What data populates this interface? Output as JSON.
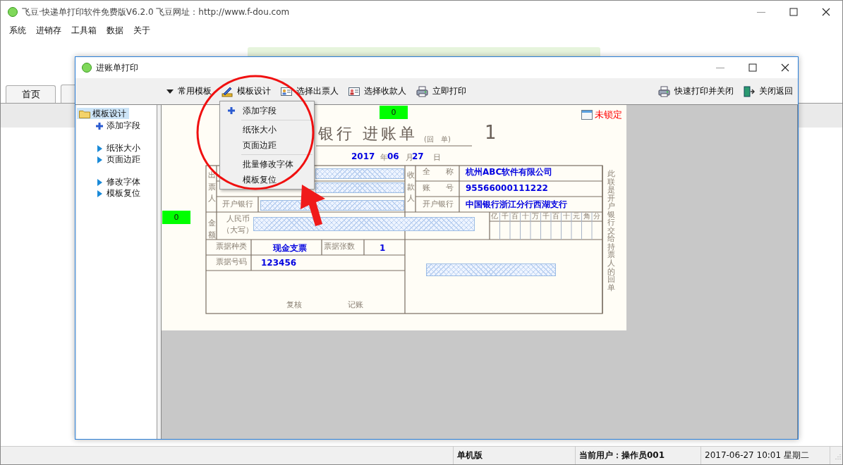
{
  "window": {
    "title": "飞豆·快递单打印软件免费版V6.2.0  飞豆网址：http://www.f-dou.com"
  },
  "menu": [
    "系统",
    "进销存",
    "工具箱",
    "数据",
    "关于"
  ],
  "tabs": [
    "首页"
  ],
  "status_bar": [
    {
      "text": "单机版",
      "kind": "label"
    },
    {
      "text": "当前用户：操作员001",
      "kind": "label"
    },
    {
      "text": "2017-06-27 10:01 星期二",
      "kind": "clock"
    }
  ],
  "dialog": {
    "title": "进账单打印",
    "toolbar_left": [
      "常用模板",
      "模板设计",
      "选择出票人",
      "选择收款人",
      "立即打印"
    ],
    "toolbar_right": [
      "快速打印并关闭",
      "关闭返回"
    ],
    "tree": {
      "label": "模板设计",
      "selected": true,
      "sections": [
        {
          "children": [
            {
              "label": "添加字段",
              "kind": "add"
            }
          ]
        },
        {
          "children": [
            {
              "label": "纸张大小",
              "kind": "action"
            },
            {
              "label": "页面边距",
              "kind": "action"
            }
          ]
        },
        {
          "children": [
            {
              "label": "修改字体",
              "kind": "action"
            },
            {
              "label": "模板复位",
              "kind": "action"
            }
          ]
        }
      ]
    },
    "dropdown_menu": [
      {
        "items": [
          {
            "label": "添加字段",
            "kind": "add"
          }
        ]
      },
      {
        "items": [
          {
            "label": "纸张大小",
            "kind": "plain"
          },
          {
            "label": "页面边距",
            "kind": "plain"
          }
        ]
      },
      {
        "items": [
          {
            "label": "批量修改字体",
            "kind": "plain"
          },
          {
            "label": "模板复位",
            "kind": "plain"
          }
        ]
      }
    ],
    "canvas": {
      "counters": [
        "0",
        "0"
      ],
      "lock_status": "未锁定",
      "form": [
        {
          "text": "银行  进账单",
          "kind": "title"
        },
        {
          "text": "(回　单)",
          "kind": "small"
        },
        {
          "text": "1",
          "kind": "number"
        },
        {
          "text": "2017",
          "kind": "value"
        },
        {
          "text": "年",
          "kind": "printed"
        },
        {
          "text": "06",
          "kind": "value"
        },
        {
          "text": "月",
          "kind": "printed"
        },
        {
          "text": "27",
          "kind": "value"
        },
        {
          "text": "日",
          "kind": "printed"
        },
        {
          "text": "出票人",
          "kind": "vertical"
        },
        {
          "text": "开户银行",
          "kind": "printed"
        },
        {
          "text": "收款人",
          "kind": "vertical"
        },
        {
          "text": "全　　称",
          "kind": "printed"
        },
        {
          "text": "账　　号",
          "kind": "printed"
        },
        {
          "text": "开户银行",
          "kind": "printed"
        },
        {
          "text": "杭州ABC软件有限公司",
          "kind": "value"
        },
        {
          "text": "95566000111222",
          "kind": "value"
        },
        {
          "text": "中国银行浙江分行西湖支行",
          "kind": "value"
        },
        {
          "text": "金额",
          "kind": "vertical"
        },
        {
          "text": "人民币",
          "kind": "printed"
        },
        {
          "text": "（大写）",
          "kind": "printed"
        },
        {
          "text": "票据种类",
          "kind": "printed"
        },
        {
          "text": "现金支票",
          "kind": "value"
        },
        {
          "text": "票据张数",
          "kind": "printed"
        },
        {
          "text": "1",
          "kind": "value"
        },
        {
          "text": "票据号码",
          "kind": "printed"
        },
        {
          "text": "123456",
          "kind": "value"
        },
        {
          "text": "复核",
          "kind": "printed"
        },
        {
          "text": "记账",
          "kind": "printed"
        },
        {
          "text": "此联是开户银行交给持票人的回单",
          "kind": "vertical"
        }
      ],
      "digit_units": [
        "亿",
        "千",
        "百",
        "十",
        "万",
        "千",
        "百",
        "十",
        "元",
        "角",
        "分"
      ]
    }
  }
}
